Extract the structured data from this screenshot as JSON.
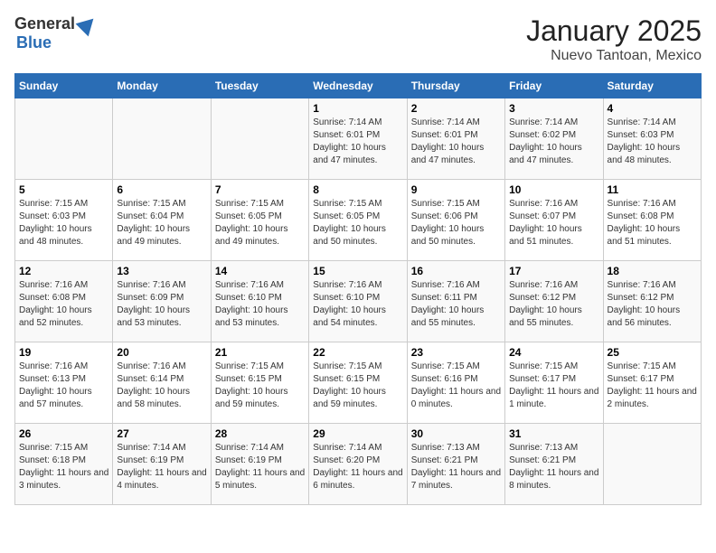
{
  "header": {
    "logo_general": "General",
    "logo_blue": "Blue",
    "title": "January 2025",
    "subtitle": "Nuevo Tantoan, Mexico"
  },
  "weekdays": [
    "Sunday",
    "Monday",
    "Tuesday",
    "Wednesday",
    "Thursday",
    "Friday",
    "Saturday"
  ],
  "weeks": [
    [
      {
        "day": "",
        "info": ""
      },
      {
        "day": "",
        "info": ""
      },
      {
        "day": "",
        "info": ""
      },
      {
        "day": "1",
        "info": "Sunrise: 7:14 AM\nSunset: 6:01 PM\nDaylight: 10 hours and 47 minutes."
      },
      {
        "day": "2",
        "info": "Sunrise: 7:14 AM\nSunset: 6:01 PM\nDaylight: 10 hours and 47 minutes."
      },
      {
        "day": "3",
        "info": "Sunrise: 7:14 AM\nSunset: 6:02 PM\nDaylight: 10 hours and 47 minutes."
      },
      {
        "day": "4",
        "info": "Sunrise: 7:14 AM\nSunset: 6:03 PM\nDaylight: 10 hours and 48 minutes."
      }
    ],
    [
      {
        "day": "5",
        "info": "Sunrise: 7:15 AM\nSunset: 6:03 PM\nDaylight: 10 hours and 48 minutes."
      },
      {
        "day": "6",
        "info": "Sunrise: 7:15 AM\nSunset: 6:04 PM\nDaylight: 10 hours and 49 minutes."
      },
      {
        "day": "7",
        "info": "Sunrise: 7:15 AM\nSunset: 6:05 PM\nDaylight: 10 hours and 49 minutes."
      },
      {
        "day": "8",
        "info": "Sunrise: 7:15 AM\nSunset: 6:05 PM\nDaylight: 10 hours and 50 minutes."
      },
      {
        "day": "9",
        "info": "Sunrise: 7:15 AM\nSunset: 6:06 PM\nDaylight: 10 hours and 50 minutes."
      },
      {
        "day": "10",
        "info": "Sunrise: 7:16 AM\nSunset: 6:07 PM\nDaylight: 10 hours and 51 minutes."
      },
      {
        "day": "11",
        "info": "Sunrise: 7:16 AM\nSunset: 6:08 PM\nDaylight: 10 hours and 51 minutes."
      }
    ],
    [
      {
        "day": "12",
        "info": "Sunrise: 7:16 AM\nSunset: 6:08 PM\nDaylight: 10 hours and 52 minutes."
      },
      {
        "day": "13",
        "info": "Sunrise: 7:16 AM\nSunset: 6:09 PM\nDaylight: 10 hours and 53 minutes."
      },
      {
        "day": "14",
        "info": "Sunrise: 7:16 AM\nSunset: 6:10 PM\nDaylight: 10 hours and 53 minutes."
      },
      {
        "day": "15",
        "info": "Sunrise: 7:16 AM\nSunset: 6:10 PM\nDaylight: 10 hours and 54 minutes."
      },
      {
        "day": "16",
        "info": "Sunrise: 7:16 AM\nSunset: 6:11 PM\nDaylight: 10 hours and 55 minutes."
      },
      {
        "day": "17",
        "info": "Sunrise: 7:16 AM\nSunset: 6:12 PM\nDaylight: 10 hours and 55 minutes."
      },
      {
        "day": "18",
        "info": "Sunrise: 7:16 AM\nSunset: 6:12 PM\nDaylight: 10 hours and 56 minutes."
      }
    ],
    [
      {
        "day": "19",
        "info": "Sunrise: 7:16 AM\nSunset: 6:13 PM\nDaylight: 10 hours and 57 minutes."
      },
      {
        "day": "20",
        "info": "Sunrise: 7:16 AM\nSunset: 6:14 PM\nDaylight: 10 hours and 58 minutes."
      },
      {
        "day": "21",
        "info": "Sunrise: 7:15 AM\nSunset: 6:15 PM\nDaylight: 10 hours and 59 minutes."
      },
      {
        "day": "22",
        "info": "Sunrise: 7:15 AM\nSunset: 6:15 PM\nDaylight: 10 hours and 59 minutes."
      },
      {
        "day": "23",
        "info": "Sunrise: 7:15 AM\nSunset: 6:16 PM\nDaylight: 11 hours and 0 minutes."
      },
      {
        "day": "24",
        "info": "Sunrise: 7:15 AM\nSunset: 6:17 PM\nDaylight: 11 hours and 1 minute."
      },
      {
        "day": "25",
        "info": "Sunrise: 7:15 AM\nSunset: 6:17 PM\nDaylight: 11 hours and 2 minutes."
      }
    ],
    [
      {
        "day": "26",
        "info": "Sunrise: 7:15 AM\nSunset: 6:18 PM\nDaylight: 11 hours and 3 minutes."
      },
      {
        "day": "27",
        "info": "Sunrise: 7:14 AM\nSunset: 6:19 PM\nDaylight: 11 hours and 4 minutes."
      },
      {
        "day": "28",
        "info": "Sunrise: 7:14 AM\nSunset: 6:19 PM\nDaylight: 11 hours and 5 minutes."
      },
      {
        "day": "29",
        "info": "Sunrise: 7:14 AM\nSunset: 6:20 PM\nDaylight: 11 hours and 6 minutes."
      },
      {
        "day": "30",
        "info": "Sunrise: 7:13 AM\nSunset: 6:21 PM\nDaylight: 11 hours and 7 minutes."
      },
      {
        "day": "31",
        "info": "Sunrise: 7:13 AM\nSunset: 6:21 PM\nDaylight: 11 hours and 8 minutes."
      },
      {
        "day": "",
        "info": ""
      }
    ]
  ]
}
